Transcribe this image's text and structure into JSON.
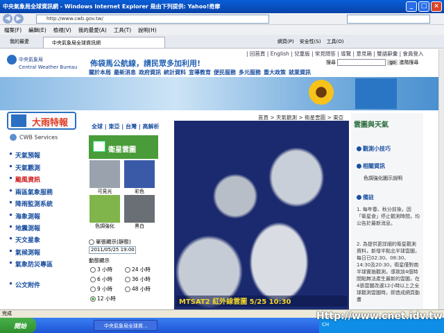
{
  "window": {
    "title": "中央氣象局全球資訊網 - Windows Internet Explorer 是由下列提供: Yahoo!奇摩",
    "url": "http://www.cwb.gov.tw/"
  },
  "menu": [
    "檔案(F)",
    "編輯(E)",
    "檢視(V)",
    "我的最愛(A)",
    "工具(T)",
    "說明(H)"
  ],
  "tabs": {
    "favorites": "我的最愛",
    "active": "中央氣象局全球資訊網",
    "tools": [
      "網頁(P)",
      "安全性(S)",
      "工具(O)"
    ]
  },
  "header": {
    "logo_cn": "中央氣象局",
    "logo_en": "Central Weather Bureau",
    "toplinks": "| 回首頁 | English | 兒童版 | 常見問答 | 導覽 | 意見箱 | 雙語辭彙 | 會員登入",
    "slogan": "佈袋馬公航線，請民眾多加利用!",
    "search_label": "搜尋",
    "search_go": "go",
    "adv_search": "進階搜尋",
    "mainnav": [
      "關於本局",
      "最新消息",
      "政府資訊",
      "統計資料",
      "宣導教育",
      "便民服務",
      "多元服務",
      "重大政策",
      "就業資訊"
    ]
  },
  "left": {
    "special": "大雨特報",
    "cwb_services": "CWB Services",
    "nav": [
      "天氣預報",
      "天氣觀測",
      "颱風資訊",
      "兩區氣象服務",
      "降雨監測系統",
      "海象測報",
      "地震測報",
      "天文星象",
      "氣候測報",
      "氣象防災專區"
    ],
    "bottom": "公文附件"
  },
  "center": {
    "crumb_left": "全球 | 東亞 | 台灣 | 高解析",
    "crumb_right": "首頁 > 天氣觀測 > 衛星雲圖 > 東亞",
    "sat_button": "衛星雲圖",
    "thumbs": [
      "可見光",
      "彩色",
      "色調強化",
      "黑白"
    ],
    "single_label": "單張顯示(靜態)",
    "date_value": "2011/05/25 19:00",
    "anim_label": "動態顯示",
    "hours": [
      "3 小時",
      "24 小時",
      "6 小時",
      "36 小時",
      "9 小時",
      "48 小時",
      "12 小時"
    ],
    "sat_caption": "MTSAT2 紅外線雲圖     5/25 10:30"
  },
  "right": {
    "title": "雲圖與天氣",
    "h1": "觀測小技巧",
    "h2": "相關資訊",
    "link": "色調強化圖示說明",
    "h3": "備註",
    "note1": "1. 每年春、秋分前後，因「衛星食」停止觀測時間，均公告於最新消息。",
    "note2": "2. 為提供更詳細的衛星觀測資料，新增半點北半球雲圖，每日已02:30、08:30、14:30及20:30，衛星僅對南半球實施觀測，導致該4個時間點無法產生最新的雲圖，在4張雲圖改選12小時以上之全球觀測雲圖時，即造成網頁動畫"
  },
  "status": "完成",
  "taskbar": {
    "start": "開始",
    "task": "中央氣象局全球資...",
    "clock": "CH"
  },
  "watermark": "Http://www.cnet.idv.tw"
}
